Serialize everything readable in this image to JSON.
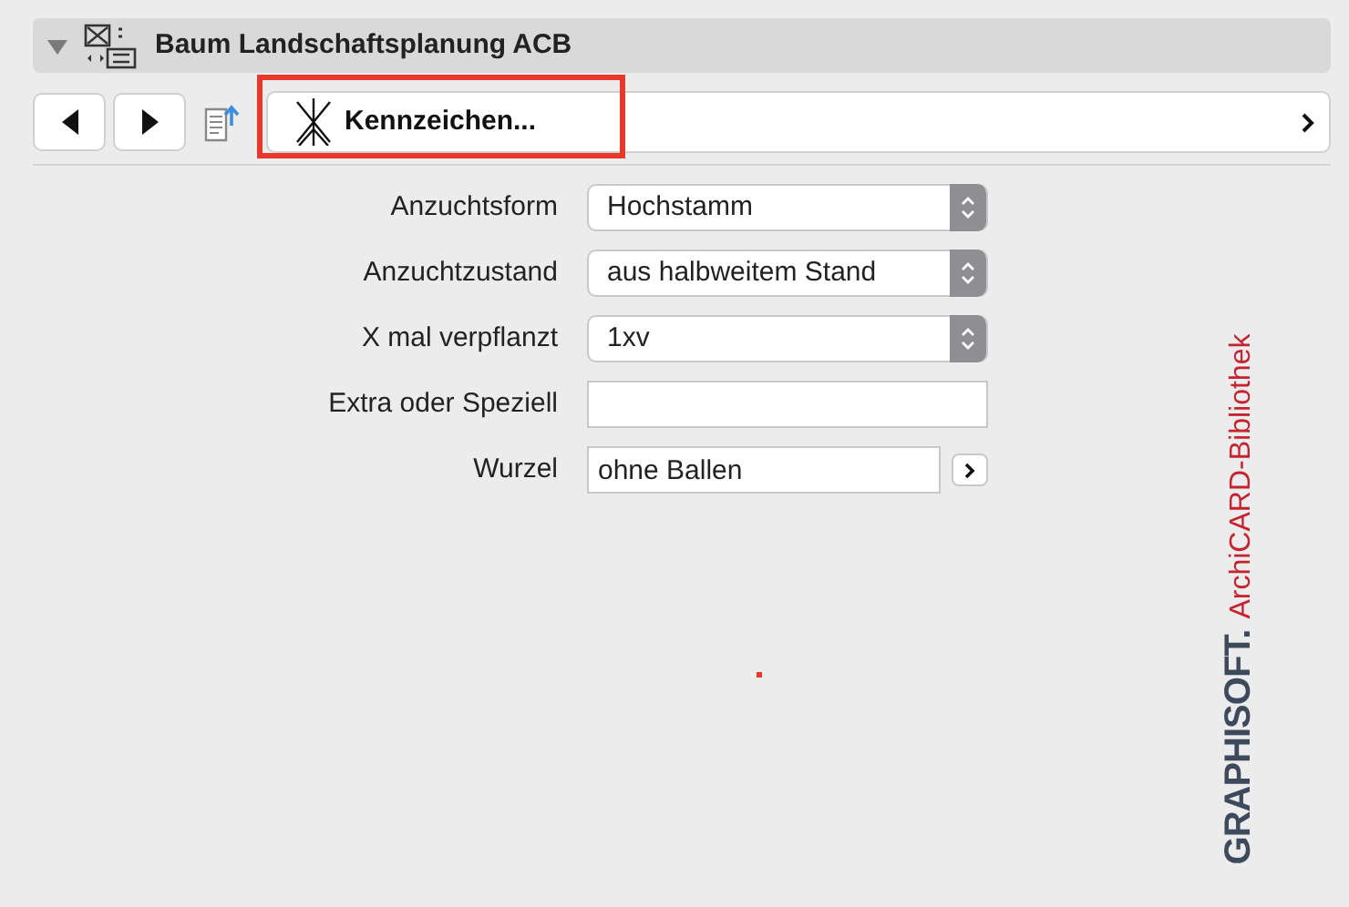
{
  "panel": {
    "title": "Baum Landschaftsplanung ACB",
    "expanded": true
  },
  "nav": {
    "current": {
      "label": "Kennzeichen...",
      "highlighted": true
    }
  },
  "fields": [
    {
      "kind": "select",
      "label": "Anzuchtsform",
      "value": "Hochstamm"
    },
    {
      "kind": "select",
      "label": "Anzuchtzustand",
      "value": "aus halbweitem Stand"
    },
    {
      "kind": "select",
      "label": "X mal verpflanzt",
      "value": "1xv"
    },
    {
      "kind": "text",
      "label": "Extra oder Speziell"
    },
    {
      "kind": "text_button",
      "label": "Wurzel",
      "value": "ohne Ballen"
    }
  ],
  "logo": {
    "brand": "GRAPHISOFT.",
    "library": "ArchiCARD-Bibliothek"
  }
}
